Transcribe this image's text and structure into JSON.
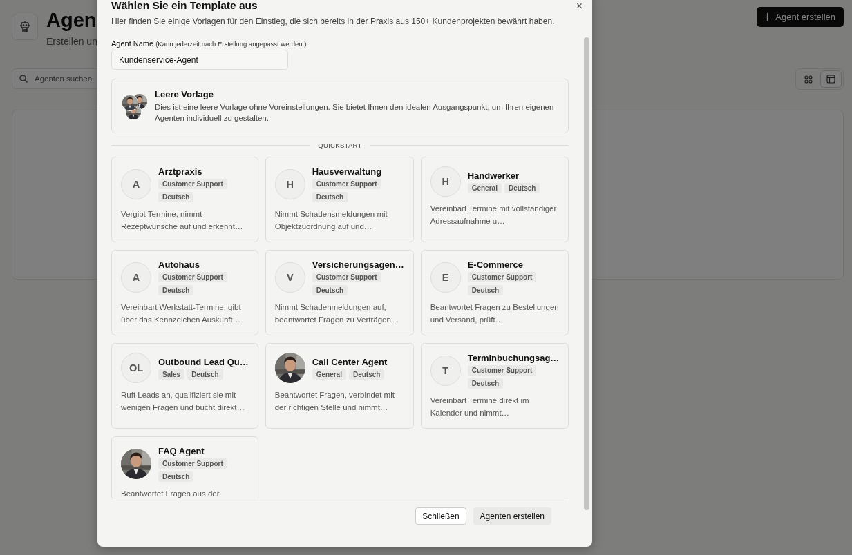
{
  "page": {
    "title": "Agen",
    "subtitle": "Erstellen un",
    "create_button": "Agent erstellen",
    "search": {
      "placeholder": "Agenten suchen."
    },
    "view_toggle": [
      {
        "selected": false
      },
      {
        "selected": true
      }
    ]
  },
  "dialog": {
    "title": "Wählen Sie ein Template aus",
    "close": "×",
    "description": "Hier finden Sie einige Vorlagen für den Einstieg, die sich bereits in der Praxis aus 150+ Kundenprojekten bewährt haben.",
    "name_label": "Agent Name",
    "name_hint": "(Kann jederzeit nach Erstellung angepasst werden.)",
    "name_value": "Kundenservice-Agent",
    "blank_template": {
      "title": "Leere Vorlage",
      "description": "Dies ist eine leere Vorlage ohne Voreinstellungen. Sie bietet Ihnen den idealen Ausgangspunkt, um Ihren eigenen Agenten individuell zu gestalten."
    },
    "section_label": "QUICKSTART",
    "templates": [
      {
        "name": "Arztpraxis",
        "avatar": {
          "kind": "letter",
          "text": "A"
        },
        "tags": [
          "Customer Support",
          "Deutsch"
        ],
        "description": "Vergibt Termine, nimmt Rezeptwünsche auf und erkennt…"
      },
      {
        "name": "Hausverwaltung",
        "avatar": {
          "kind": "letter",
          "text": "H"
        },
        "tags": [
          "Customer Support",
          "Deutsch"
        ],
        "description": "Nimmt Schadensmeldungen mit Objektzuordnung auf und…"
      },
      {
        "name": "Handwerker",
        "avatar": {
          "kind": "letter",
          "text": "H"
        },
        "tags": [
          "General",
          "Deutsch"
        ],
        "description": "Vereinbart Termine mit vollständiger Adressaufnahme u…"
      },
      {
        "name": "Autohaus",
        "avatar": {
          "kind": "letter",
          "text": "A"
        },
        "tags": [
          "Customer Support",
          "Deutsch"
        ],
        "description": "Vereinbart Werkstatt-Termine, gibt über das Kennzeichen Auskunft…"
      },
      {
        "name": "Versicherungsagen…",
        "avatar": {
          "kind": "letter",
          "text": "V"
        },
        "tags": [
          "Customer Support",
          "Deutsch"
        ],
        "description": "Nimmt Schadenmeldungen auf, beantwortet Fragen zu Verträgen…"
      },
      {
        "name": "E-Commerce",
        "avatar": {
          "kind": "letter",
          "text": "E"
        },
        "tags": [
          "Customer Support",
          "Deutsch"
        ],
        "description": "Beantwortet Fragen zu Bestellungen und Versand, prüft…"
      },
      {
        "name": "Outbound Lead Qu…",
        "avatar": {
          "kind": "letter",
          "text": "OL"
        },
        "tags": [
          "Sales",
          "Deutsch"
        ],
        "description": "Ruft Leads an, qualifiziert sie mit wenigen Fragen und bucht direkt…"
      },
      {
        "name": "Call Center Agent",
        "tags": [
          "General",
          "Deutsch"
        ],
        "description": "Beantwortet Fragen, verbindet mit der richtigen Stelle und nimmt…"
      },
      {
        "name": "Terminbuchungsag…",
        "avatar": {
          "kind": "letter",
          "text": "T"
        },
        "tags": [
          "Customer Support",
          "Deutsch"
        ],
        "description": "Vereinbart Termine direkt im Kalender und nimmt…"
      },
      {
        "name": "FAQ Agent",
        "tags": [
          "Customer Support",
          "Deutsch"
        ],
        "description": "Beantwortet Fragen aus der"
      }
    ],
    "buttons": [
      "Schließen",
      "Agenten erstellen"
    ]
  }
}
